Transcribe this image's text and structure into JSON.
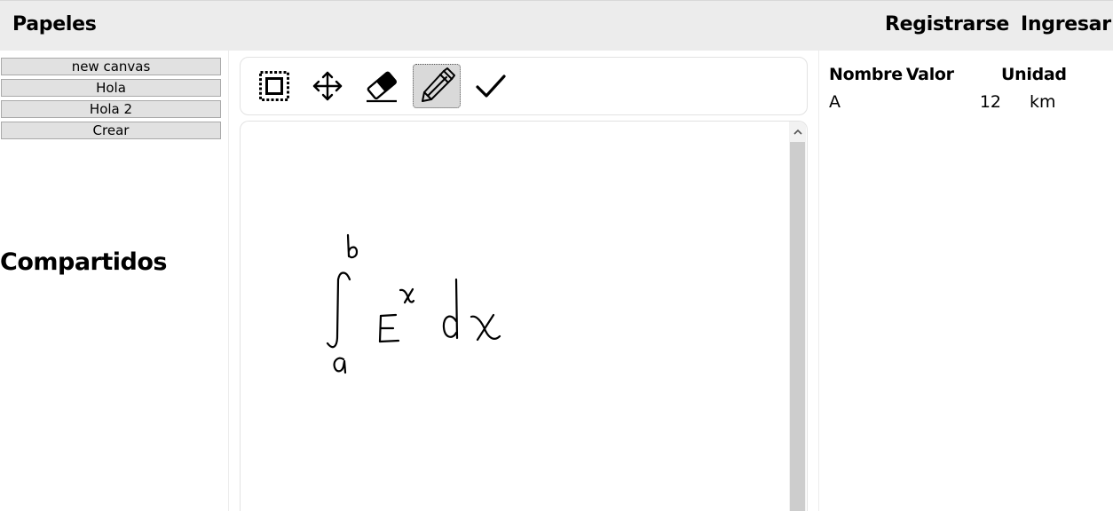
{
  "header": {
    "brand": "Papeles",
    "register_label": "Registrarse",
    "login_label": "Ingresar"
  },
  "sidebar": {
    "papers": [
      "new canvas",
      "Hola",
      "Hola 2"
    ],
    "create_label": "Crear",
    "shared_title": "Compartidos"
  },
  "toolbar": {
    "tools": [
      {
        "name": "select-tool",
        "icon": "dashed-selection-icon"
      },
      {
        "name": "move-tool",
        "icon": "move-arrows-icon"
      },
      {
        "name": "eraser-tool",
        "icon": "eraser-icon"
      },
      {
        "name": "pen-tool",
        "icon": "pen-icon",
        "active": true
      },
      {
        "name": "confirm-tool",
        "icon": "checkmark-icon"
      }
    ]
  },
  "canvas": {
    "handwriting": "∫ₐᵇ eˣ dx"
  },
  "variables": {
    "headers": [
      "Nombre",
      "Valor",
      "Unidad"
    ],
    "rows": [
      {
        "name": "A",
        "value": "12",
        "unit": "km"
      }
    ]
  },
  "colors": {
    "topbar_bg": "#ececec",
    "button_bg": "#e1e1e1",
    "active_tool_bg": "#d9d9d9",
    "scroll_thumb": "#cdcdcd"
  }
}
